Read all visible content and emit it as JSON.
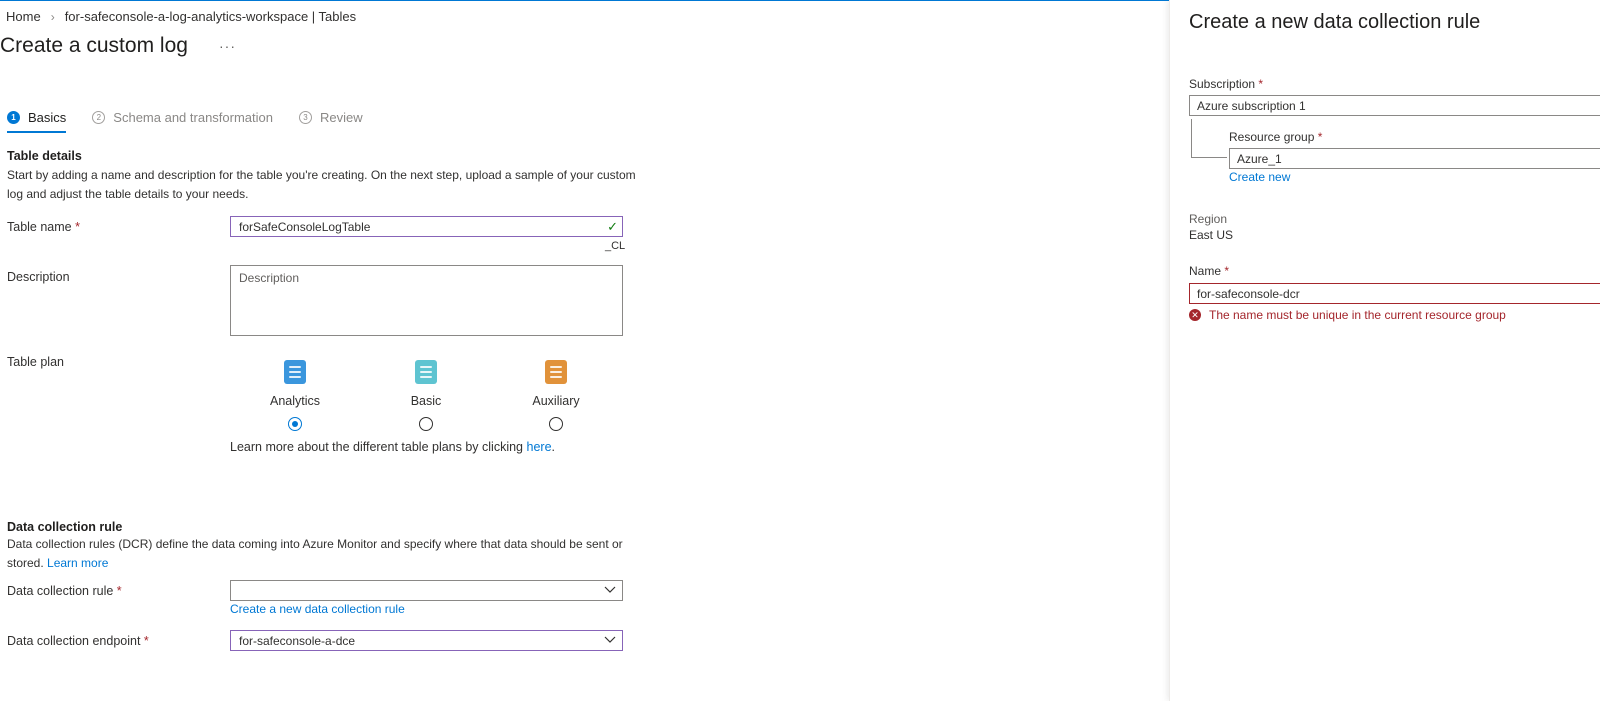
{
  "breadcrumb": {
    "home": "Home",
    "workspace": "for-safeconsole-a-log-analytics-workspace | Tables"
  },
  "page": {
    "title": "Create a custom log",
    "more": "···"
  },
  "steps": [
    {
      "num": "1",
      "label": "Basics"
    },
    {
      "num": "2",
      "label": "Schema and transformation"
    },
    {
      "num": "3",
      "label": "Review"
    }
  ],
  "table_details": {
    "title": "Table details",
    "desc_line1": "Start by adding a name and description for the table you're creating. On the next step, upload a sample of your custom",
    "desc_line2": "log and adjust the table details to your needs.",
    "table_name_label": "Table name",
    "table_name_value": "forSafeConsoleLogTable",
    "table_suffix": "_CL",
    "description_label": "Description",
    "description_placeholder": "Description",
    "table_plan_label": "Table plan"
  },
  "plans": [
    {
      "label": "Analytics",
      "color": "#3a96dd",
      "selected": true
    },
    {
      "label": "Basic",
      "color": "#5ec4d1",
      "selected": false
    },
    {
      "label": "Auxiliary",
      "color": "#e1923a",
      "selected": false
    }
  ],
  "plans_learn": {
    "text": "Learn more about the different table plans by clicking",
    "link": "here",
    "period": "."
  },
  "dcr": {
    "title": "Data collection rule",
    "desc_line1": "Data collection rules (DCR) define the data coming into Azure Monitor and specify where that data should be sent or",
    "desc_line2_prefix": "stored.",
    "learn_more": "Learn more",
    "rule_label": "Data collection rule",
    "rule_value": "",
    "create_new_link": "Create a new data collection rule",
    "endpoint_label": "Data collection endpoint",
    "endpoint_value": "for-safeconsole-a-dce"
  },
  "required_mark": "*",
  "side_panel": {
    "title": "Create a new data collection rule",
    "subscription_label": "Subscription",
    "subscription_value": "Azure subscription 1",
    "resource_group_label": "Resource group",
    "resource_group_value": "Azure_1",
    "create_new": "Create new",
    "region_label": "Region",
    "region_value": "East US",
    "name_label": "Name",
    "name_value": "for-safeconsole-dcr",
    "name_error": "The name must be unique in the current resource group"
  },
  "colors": {
    "accent": "#0078d4",
    "error": "#a4262c",
    "valid": "#107c10",
    "focus_border": "#8764b8"
  }
}
